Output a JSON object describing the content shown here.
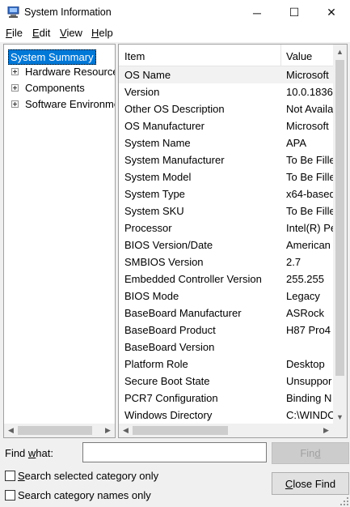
{
  "window": {
    "title": "System Information",
    "icon": "system-information-icon",
    "controls": {
      "minimize": "─",
      "maximize": "☐",
      "close": "✕"
    }
  },
  "menu": [
    {
      "label": "File",
      "accel": "F",
      "rest": "ile"
    },
    {
      "label": "Edit",
      "accel": "E",
      "rest": "dit"
    },
    {
      "label": "View",
      "accel": "V",
      "rest": "iew"
    },
    {
      "label": "Help",
      "accel": "H",
      "rest": "elp"
    }
  ],
  "tree": {
    "items": [
      {
        "label": "System Summary",
        "selected": true,
        "expandable": false
      },
      {
        "label": "Hardware Resources",
        "selected": false,
        "expandable": true
      },
      {
        "label": "Components",
        "selected": false,
        "expandable": true
      },
      {
        "label": "Software Environment",
        "selected": false,
        "expandable": true
      }
    ]
  },
  "list": {
    "columns": [
      "Item",
      "Value"
    ],
    "rows": [
      {
        "item": "OS Name",
        "value": "Microsoft"
      },
      {
        "item": "Version",
        "value": "10.0.1836"
      },
      {
        "item": "Other OS Description",
        "value": "Not Availa"
      },
      {
        "item": "OS Manufacturer",
        "value": "Microsoft"
      },
      {
        "item": "System Name",
        "value": "APA"
      },
      {
        "item": "System Manufacturer",
        "value": "To Be Fille"
      },
      {
        "item": "System Model",
        "value": "To Be Fille"
      },
      {
        "item": "System Type",
        "value": "x64-based"
      },
      {
        "item": "System SKU",
        "value": "To Be Fille"
      },
      {
        "item": "Processor",
        "value": "Intel(R) Pe"
      },
      {
        "item": "BIOS Version/Date",
        "value": "American"
      },
      {
        "item": "SMBIOS Version",
        "value": "2.7"
      },
      {
        "item": "Embedded Controller Version",
        "value": "255.255"
      },
      {
        "item": "BIOS Mode",
        "value": "Legacy"
      },
      {
        "item": "BaseBoard Manufacturer",
        "value": "ASRock"
      },
      {
        "item": "BaseBoard Product",
        "value": "H87 Pro4"
      },
      {
        "item": "BaseBoard Version",
        "value": ""
      },
      {
        "item": "Platform Role",
        "value": "Desktop"
      },
      {
        "item": "Secure Boot State",
        "value": "Unsuppor"
      },
      {
        "item": "PCR7 Configuration",
        "value": "Binding N"
      },
      {
        "item": "Windows Directory",
        "value": "C:\\WINDO"
      }
    ]
  },
  "search": {
    "find_label": "Find what:",
    "find_label_accel": "w",
    "find_value": "",
    "find_button": "Find",
    "close_find_button": "Close Find",
    "option_selected_only": "Search selected category only",
    "option_names_only": "Search category names only"
  },
  "colors": {
    "selection_blue": "#0078d7",
    "window_bg": "#f0f0f0"
  }
}
